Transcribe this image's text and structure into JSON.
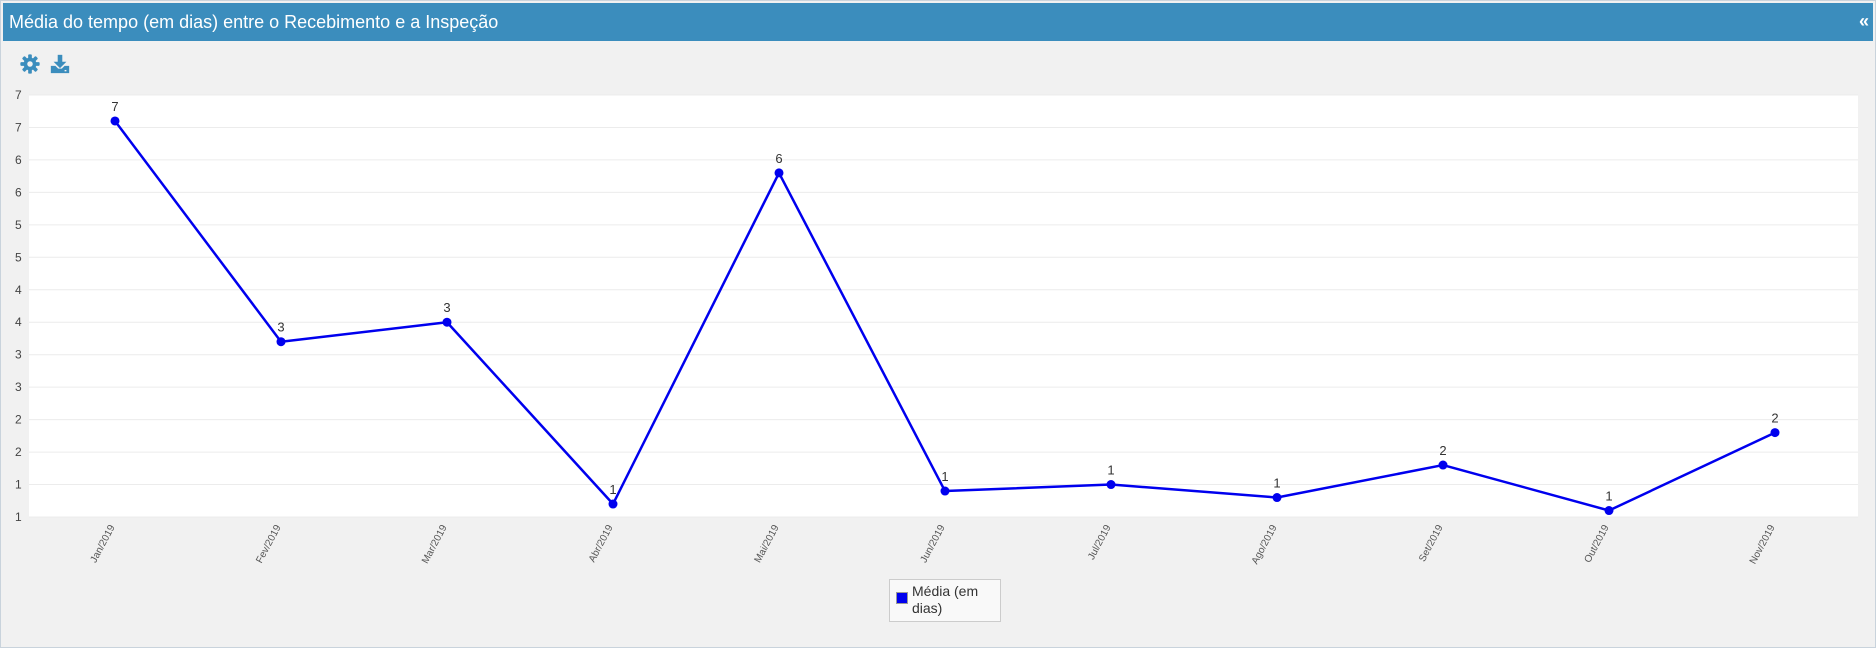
{
  "header": {
    "title": "Média do tempo (em dias) entre o Recebimento e a Inspeção",
    "collapse_label": "«"
  },
  "toolbar": {
    "icons": [
      "gear-icon",
      "download-icon"
    ]
  },
  "colors": {
    "header_bg": "#3b8dbd",
    "series": "#0000ee",
    "icon": "#3b8dbd"
  },
  "chart_data": {
    "type": "line",
    "title": "",
    "xlabel": "",
    "ylabel": "",
    "grid": true,
    "legend_position": "bottom-center",
    "y_tick_labels": [
      "1",
      "1",
      "2",
      "2",
      "3",
      "3",
      "4",
      "4",
      "5",
      "5",
      "6",
      "6",
      "7",
      "7"
    ],
    "ylim": [
      1,
      7.5
    ],
    "categories": [
      "Jan/2019",
      "Fev/2019",
      "Mar/2019",
      "Abr/2019",
      "Mai/2019",
      "Jun/2019",
      "Jul/2019",
      "Ago/2019",
      "Set/2019",
      "Out/2019",
      "Nov/2019"
    ],
    "series": [
      {
        "name": "Média (em dias)",
        "color": "#0000ee",
        "values": [
          7.1,
          3.7,
          4.0,
          1.2,
          6.3,
          1.4,
          1.5,
          1.3,
          1.8,
          1.1,
          2.3
        ],
        "data_labels": [
          "7",
          "3",
          "3",
          "1",
          "6",
          "1",
          "1",
          "1",
          "2",
          "1",
          "2"
        ]
      }
    ]
  }
}
